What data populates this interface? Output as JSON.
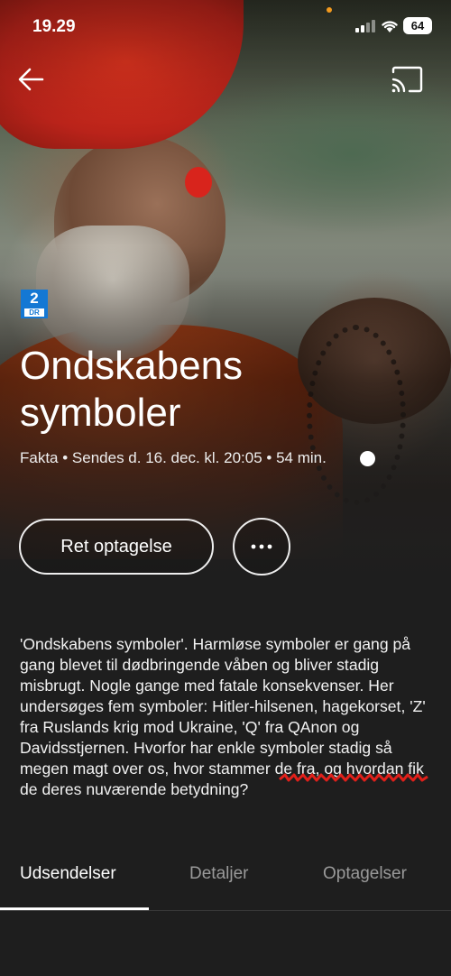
{
  "status_bar": {
    "time": "19.29",
    "battery": "64"
  },
  "program": {
    "channel": {
      "number": "2",
      "brand": "DR",
      "color": "#1478d4"
    },
    "title": "Ondskabens symboler",
    "meta": "Fakta • Sendes d. 16. dec. kl. 20:05 • 54 min.",
    "record_label": "Ret optagelse",
    "more_icon": "ellipsis-icon",
    "description": "'Ondskabens symboler'. Harmløse symboler er gang på gang blevet til dødbringende våben og bliver stadig misbrugt. Nogle gange med fatale konsekvenser. Her undersøges fem symboler: Hitler-hilsenen, hagekorset, 'Z' fra Ruslands krig mod Ukraine, 'Q' fra QAnon og Davidsstjernen. Hvorfor har enkle symboler stadig så megen magt over os, hvor stammer de fra, og hvordan fik de deres nuværende betydning?"
  },
  "tabs": [
    {
      "label": "Udsendelser",
      "active": true
    },
    {
      "label": "Detaljer",
      "active": false
    },
    {
      "label": "Optagelser",
      "active": false
    }
  ],
  "colors": {
    "background": "#1e1e1e",
    "scribble": "#e0201a",
    "status_dot": "#f39a1e"
  }
}
